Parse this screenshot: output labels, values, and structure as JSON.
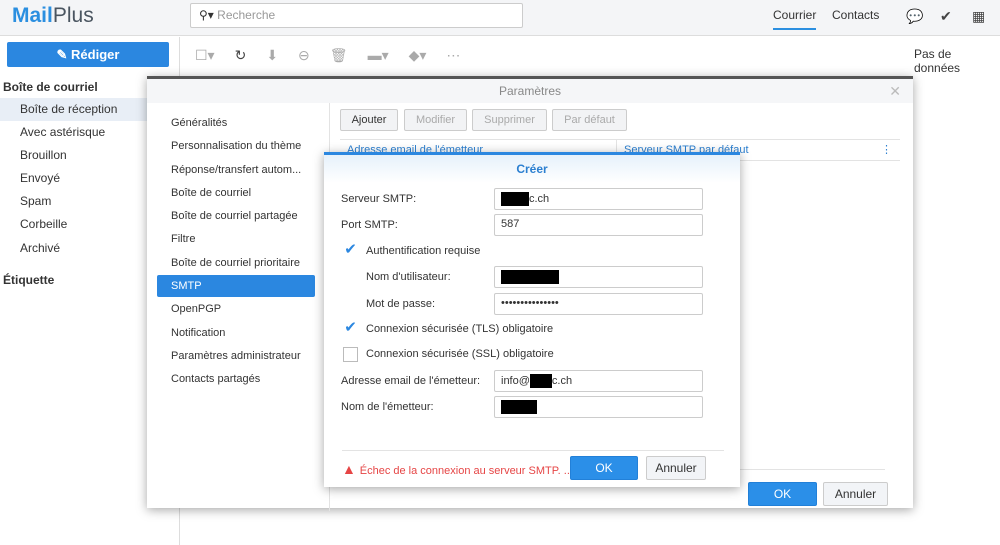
{
  "app": {
    "logo_a": "Mail",
    "logo_b": "Plus",
    "search_placeholder": "Recherche",
    "tabs": [
      "Courrier",
      "Contacts"
    ],
    "no_data": "Pas de données"
  },
  "sidebar": {
    "compose": "Rédiger",
    "mailbox_title": "Boîte de courriel",
    "items": [
      "Boîte de réception",
      "Avec astérisque",
      "Brouillon",
      "Envoyé",
      "Spam",
      "Corbeille",
      "Archivé"
    ],
    "label_title": "Étiquette"
  },
  "params": {
    "title": "Paramètres",
    "nav": [
      "Généralités",
      "Personnalisation du thème",
      "Réponse/transfert autom...",
      "Boîte de courriel",
      "Boîte de courriel partagée",
      "Filtre",
      "Boîte de courriel prioritaire",
      "SMTP",
      "OpenPGP",
      "Notification",
      "Paramètres administrateur",
      "Contacts partagés"
    ],
    "buttons": [
      "Ajouter",
      "Modifier",
      "Supprimer",
      "Par défaut"
    ],
    "columns": [
      "Adresse email de l'émetteur",
      "Serveur SMTP par défaut"
    ],
    "ok": "OK",
    "cancel": "Annuler"
  },
  "create": {
    "title": "Créer",
    "smtp_server_label": "Serveur SMTP:",
    "smtp_server_value": "c.ch",
    "port_label": "Port SMTP:",
    "port_value": "587",
    "auth_label": "Authentification requise",
    "auth_checked": true,
    "user_label": "Nom d'utilisateur:",
    "pass_label": "Mot de passe:",
    "pass_value": "•••••••••••••••",
    "tls_label": "Connexion sécurisée (TLS) obligatoire",
    "tls_checked": true,
    "ssl_label": "Connexion sécurisée (SSL) obligatoire",
    "ssl_checked": false,
    "sender_email_label": "Adresse email de l'émetteur:",
    "sender_email_prefix": "info@",
    "sender_email_suffix": "c.ch",
    "sender_name_label": "Nom de l'émetteur:",
    "error": "Échec de la connexion au serveur SMTP. ...",
    "ok": "OK",
    "cancel": "Annuler"
  }
}
